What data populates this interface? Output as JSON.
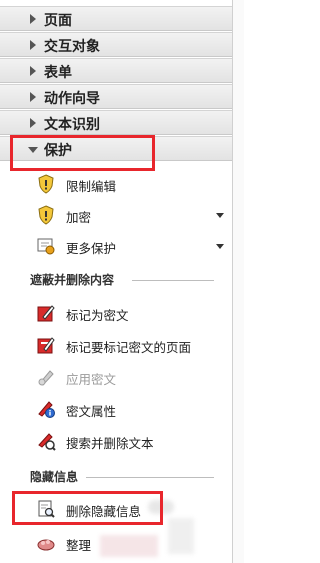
{
  "sections": [
    {
      "label": "页面"
    },
    {
      "label": "交互对象"
    },
    {
      "label": "表单"
    },
    {
      "label": "动作向导"
    },
    {
      "label": "文本识别"
    },
    {
      "label": "保护"
    }
  ],
  "protect": {
    "items": [
      {
        "label": "限制编辑"
      },
      {
        "label": "加密"
      },
      {
        "label": "更多保护"
      }
    ]
  },
  "redact_group": {
    "title": "遮蔽并删除内容",
    "items": [
      {
        "label": "标记为密文"
      },
      {
        "label": "标记要标记密文的页面"
      },
      {
        "label": "应用密文"
      },
      {
        "label": "密文属性"
      },
      {
        "label": "搜索并删除文本"
      }
    ]
  },
  "hidden_group": {
    "title": "隐藏信息",
    "items": [
      {
        "label": "删除隐藏信息"
      },
      {
        "label": "整理"
      }
    ]
  },
  "colors": {
    "highlight": "#e8262c",
    "header_bg": "#e9e9e9"
  }
}
